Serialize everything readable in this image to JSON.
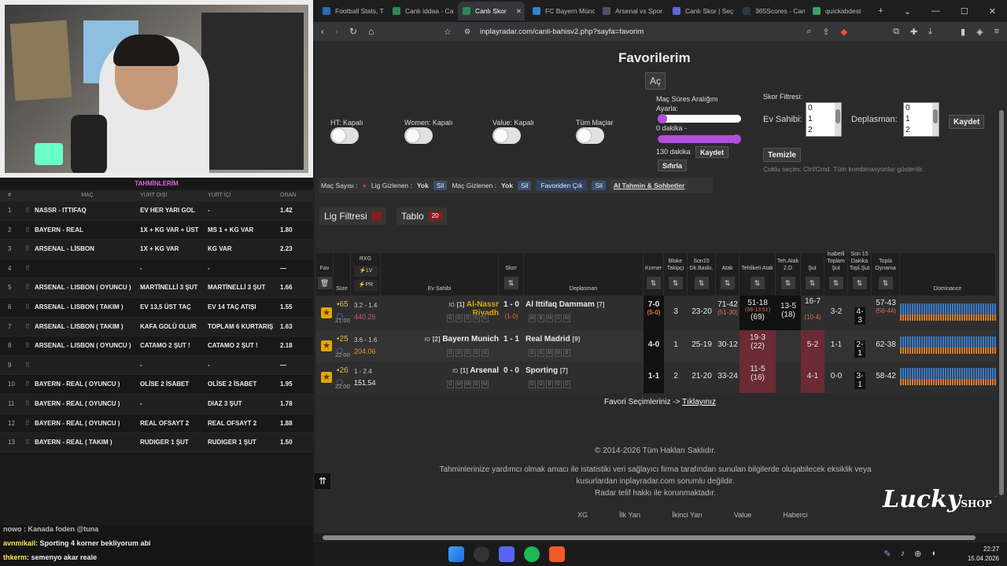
{
  "overlay": {
    "tahmin_title": "TAHMİNLERİM",
    "headers": [
      "#",
      "MAÇ",
      "YURT DIŞI",
      "YURT İÇİ",
      "ORAN"
    ],
    "rows": [
      {
        "n": "1",
        "mac": "NASSR - ITTIFAQ",
        "dis": "EV HER YARI GOL",
        "ic": "-",
        "oran": "1.42"
      },
      {
        "n": "2",
        "mac": "BAYERN - REAL",
        "dis": "1X + KG VAR + ÜST",
        "ic": "MS 1 + KG VAR",
        "oran": "1.80"
      },
      {
        "n": "3",
        "mac": "ARSENAL - LİSBON",
        "dis": "1X + KG VAR",
        "ic": "KG VAR",
        "oran": "2.23"
      },
      {
        "n": "4",
        "mac": "",
        "dis": "-",
        "ic": "-",
        "oran": "—"
      },
      {
        "n": "5",
        "mac": "ARSENAL - LISBON ( OYUNCU )",
        "dis": "MARTİNELLİ 3 ŞUT",
        "ic": "MARTİNELLİ 3 ŞUT",
        "oran": "1.66"
      },
      {
        "n": "6",
        "mac": "ARSENAL - LISBON ( TAKIM )",
        "dis": "EV 13,5 ÜST TAÇ",
        "ic": "EV 14 TAÇ ATIŞI",
        "oran": "1.55"
      },
      {
        "n": "7",
        "mac": "ARSENAL - LISBON ( TAKIM )",
        "dis": "KAFA GOLÜ OLUR",
        "ic": "TOPLAM 6 KURTARIŞ",
        "oran": "1.63"
      },
      {
        "n": "8",
        "mac": "ARSENAL - LISBON ( OYUNCU )",
        "dis": "CATAMO 2 ŞUT !",
        "ic": "CATAMO 2 ŞUT !",
        "oran": "2.18"
      },
      {
        "n": "9",
        "mac": "",
        "dis": "-",
        "ic": "-",
        "oran": "—"
      },
      {
        "n": "10",
        "mac": "BAYERN - REAL ( OYUNCU )",
        "dis": "OLİSE 2 İSABET",
        "ic": "OLİSE 2 İSABET",
        "oran": "1.95"
      },
      {
        "n": "11",
        "mac": "BAYERN - REAL ( OYUNCU )",
        "dis": "-",
        "ic": "DIAZ 3 ŞUT",
        "oran": "1.78"
      },
      {
        "n": "12",
        "mac": "BAYERN - REAL ( OYUNCU )",
        "dis": "REAL OFSAYT 2",
        "ic": "REAL OFSAYT 2",
        "oran": "1.88"
      },
      {
        "n": "13",
        "mac": "BAYERN - REAL ( TAKIM )",
        "dis": "RUDIGER 1 ŞUT",
        "ic": "RUDIGER 1 ŞUT",
        "oran": "1.50"
      }
    ],
    "chat": [
      {
        "user": "avnmikail",
        "msg": ": Sporting 4 korner bekliyorum abi"
      },
      {
        "user": "thkerm",
        "msg": ": semenyo akar reale"
      }
    ],
    "chat_partial": "nowo : Kanada foden @tuna"
  },
  "browser": {
    "tabs": [
      {
        "label": "Football Stats, T",
        "color": "#2b6cb0",
        "active": false
      },
      {
        "label": "Canlı iddaa - Ca",
        "color": "#2f855a",
        "active": false
      },
      {
        "label": "Canlı Skor",
        "color": "#2f855a",
        "active": true
      },
      {
        "label": "FC Bayern Münc",
        "color": "#3182ce",
        "active": false
      },
      {
        "label": "Arsenal vs Spor",
        "color": "#4a5568",
        "active": false
      },
      {
        "label": "Canlı Skor | Seç",
        "color": "#5a67d8",
        "active": false
      },
      {
        "label": "365Scores - Can",
        "color": "#2d3748",
        "active": false
      },
      {
        "label": "quickabdest",
        "color": "#38a169",
        "active": false
      }
    ],
    "url": "inplayradar.com/canli-bahisv2.php?sayfa=favorim"
  },
  "page": {
    "title": "Favorilerim",
    "ac_button": "Aç",
    "toggles": [
      {
        "label": "HT: Kapalı"
      },
      {
        "label": "Women: Kapalı"
      },
      {
        "label": "Value: Kapalı"
      },
      {
        "label": "Tüm Maçlar"
      }
    ],
    "range_label": "Maç Süres Aralığını Ayarla:",
    "min_label": "0 dakika -",
    "max_label": "130 dakika",
    "kaydet": "Kaydet",
    "sifirla": "Sıfırla",
    "skor_filtresi": "Skor Filtresi:",
    "ev_sahibi": "Ev Sahibi:",
    "deplasman": "Deplasman:",
    "list_values": [
      "0",
      "1",
      "2"
    ],
    "kaydet2": "Kaydet",
    "temizle": "Temizle",
    "coklu_secim": "Çoklu seçim: Ctrl/Cmd. Tüm kombinasyonlar gösterilir.",
    "filterbar": {
      "mac_sayisi": "Maç Sayısı :",
      "lig_gizlenen": "Lig Gizlenen :",
      "yok1": "Yok",
      "sil1": "Sil",
      "mac_gizlenen": "Maç Gizlenen :",
      "yok2": "Yok",
      "sil2": "Sil",
      "favoriden_cik": "Favoriden Çık",
      "sil3": "Sil",
      "ai": "AI Tahmin & Sohbetler"
    },
    "lig_filtresi": "Lig Filtresi",
    "tablo": "Tablo",
    "tablo_count": "20",
    "headers": {
      "fav": "Fav",
      "sure": "Süre",
      "rxg": "RXG",
      "lv": "LV",
      "pr": "PR",
      "ev": "Ev Sahibi",
      "skor": "Skor",
      "dep": "Deplasman",
      "korner": "Korner",
      "bloke": "Bloke Takipçi",
      "son15": "Son15 Dk.Baskı.",
      "atak": "Atak",
      "tehlikeli": "Tehlikeli Atak",
      "teh2": "Teh.Atak 2.D",
      "sut": "Şut",
      "isabetli": "İsabetli Toplam Şut",
      "son15d": "Son 15 Dakika Topl.Şut",
      "topla": "Topla Oynama",
      "dominance": "Dominance"
    },
    "matches": [
      {
        "min": "65",
        "rxg": "3.2 - 1.4",
        "time": "21:00",
        "val": "440.26",
        "valcolor": "#e0556a",
        "ev": "Al-Nassr Riyadh",
        "evrank": "[1]",
        "evcolor": "#e0a800",
        "skor": "1 - 0",
        "ht": "(1-0)",
        "dep": "Al Ittifaq Dammam",
        "deprank": "[7]",
        "evform": [
          "G",
          "G",
          "G",
          "G",
          "G"
        ],
        "depform": [
          "M",
          "B",
          "M",
          "G",
          "M"
        ],
        "korner": "7-0",
        "kornerht": "(5-0)",
        "bloke": "3",
        "son15": "23-20",
        "atak": "71-42",
        "atakht": "(51-30)",
        "tehlikeli": "51-18",
        "tehht": "(38-13:51)",
        "tehsub": "(69)",
        "teh2": "13-5",
        "teh2sub": "(18)",
        "sut": "16-7",
        "sutht": "(10-4)",
        "isabetli": "3-2",
        "son15d": "4-3",
        "topla": "57-43",
        "toplasub": "(56-44)"
      },
      {
        "min": "25",
        "rxg": "3.6 - 1.6",
        "time": "22:00",
        "val": "204.06",
        "valcolor": "#e09a2a",
        "ev": "Bayern Munich",
        "evrank": "[2]",
        "evcolor": "#eee",
        "skor": "1 - 1",
        "ht": "",
        "dep": "Real Madrid",
        "deprank": "[9]",
        "evform": [
          "G",
          "G",
          "G",
          "G",
          "G"
        ],
        "depform": [
          "G",
          "G",
          "M",
          "M",
          "B"
        ],
        "korner": "4-0",
        "kornerht": "",
        "bloke": "1",
        "son15": "25-19",
        "atak": "30-12",
        "atakht": "",
        "tehlikeli": "19-3",
        "tehht": "",
        "tehsub": "(22)",
        "teh2": "",
        "teh2sub": "",
        "sut": "5-2",
        "sutht": "",
        "isabetli": "1-1",
        "son15d": "2-1",
        "topla": "62-38",
        "toplasub": ""
      },
      {
        "min": "26",
        "rxg": "1 - 2.4",
        "time": "22:00",
        "val": "151.54",
        "valcolor": "#eee",
        "ev": "Arsenal",
        "evrank": "[1]",
        "evcolor": "#eee",
        "skor": "0 - 0",
        "ht": "",
        "dep": "Sporting",
        "deprank": "[7]",
        "evform": [
          "G",
          "M",
          "M",
          "G",
          "M"
        ],
        "depform": [
          "G",
          "G",
          "B",
          "G",
          "G"
        ],
        "korner": "1-1",
        "kornerht": "",
        "bloke": "2",
        "son15": "21-20",
        "atak": "33-24",
        "atakht": "",
        "tehlikeli": "11-5",
        "tehht": "",
        "tehsub": "(16)",
        "teh2": "",
        "teh2sub": "",
        "sut": "4-1",
        "sutht": "",
        "isabetli": "0-0",
        "son15d": "3-1",
        "topla": "58-42",
        "toplasub": ""
      }
    ],
    "fav_text": "Favori Seçimleriniz ->",
    "fav_link": "Tıklayınız",
    "copyright": "© 2014-2026 Tüm Hakları Saklıdır.",
    "disclaimer1": "Tahminlerinize yardımcı olmak amacı ile istatistiki veri sağlayıcı firma tarafından sunulan bilgilerde oluşabilecek eksiklik veya",
    "disclaimer2": "kusurlardan inplayradar.com sorumlu değildir.",
    "disclaimer3": "Radar telif hakkı ile korunmaktadır.",
    "footer_links": [
      "XG",
      "İlk Yarı",
      "İkinci Yarı",
      "Value",
      "Haberci"
    ],
    "logo": "Lucky",
    "logo_small": "SHOP"
  },
  "taskbar": {
    "time": "22:27",
    "date": "15.04.2026"
  }
}
